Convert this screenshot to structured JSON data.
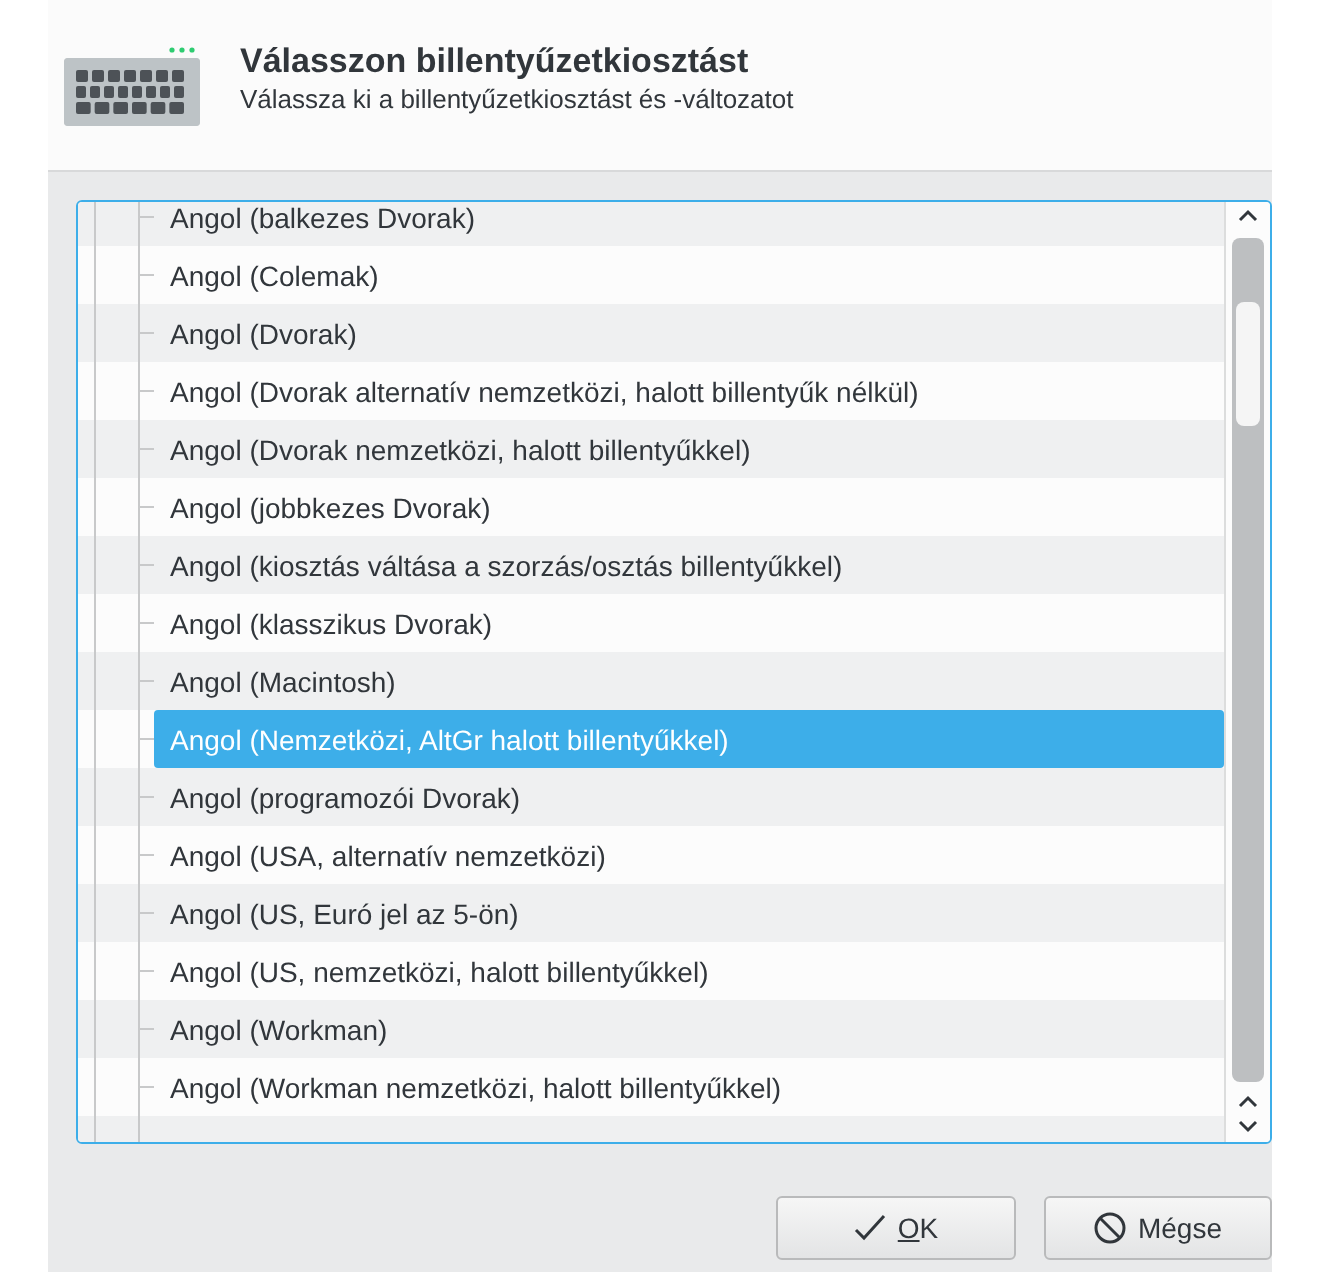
{
  "header": {
    "title": "Válasszon billentyűzetkiosztást",
    "subtitle": "Válassza ki a billentyűzetkiosztást és -változatot"
  },
  "layouts": [
    {
      "label": "Angol (balkezes Dvorak)",
      "selected": false
    },
    {
      "label": "Angol (Colemak)",
      "selected": false
    },
    {
      "label": "Angol (Dvorak)",
      "selected": false
    },
    {
      "label": "Angol (Dvorak alternatív nemzetközi, halott billentyűk nélkül)",
      "selected": false
    },
    {
      "label": "Angol (Dvorak nemzetközi, halott billentyűkkel)",
      "selected": false
    },
    {
      "label": "Angol (jobbkezes Dvorak)",
      "selected": false
    },
    {
      "label": "Angol (kiosztás váltása a szorzás/osztás billentyűkkel)",
      "selected": false
    },
    {
      "label": "Angol (klasszikus Dvorak)",
      "selected": false
    },
    {
      "label": "Angol (Macintosh)",
      "selected": false
    },
    {
      "label": "Angol (Nemzetközi, AltGr halott billentyűkkel)",
      "selected": true
    },
    {
      "label": "Angol (programozói Dvorak)",
      "selected": false
    },
    {
      "label": "Angol (USA, alternatív nemzetközi)",
      "selected": false
    },
    {
      "label": "Angol (US, Euró jel az 5-ön)",
      "selected": false
    },
    {
      "label": "Angol (US, nemzetközi, halott billentyűkkel)",
      "selected": false
    },
    {
      "label": "Angol (Workman)",
      "selected": false
    },
    {
      "label": "Angol (Workman nemzetközi, halott billentyűkkel)",
      "selected": false
    }
  ],
  "buttons": [
    {
      "kind": "ok",
      "key": "O",
      "after": "K"
    },
    {
      "kind": "cancel",
      "before": "Mé",
      "key": "g",
      "after": "se"
    }
  ]
}
